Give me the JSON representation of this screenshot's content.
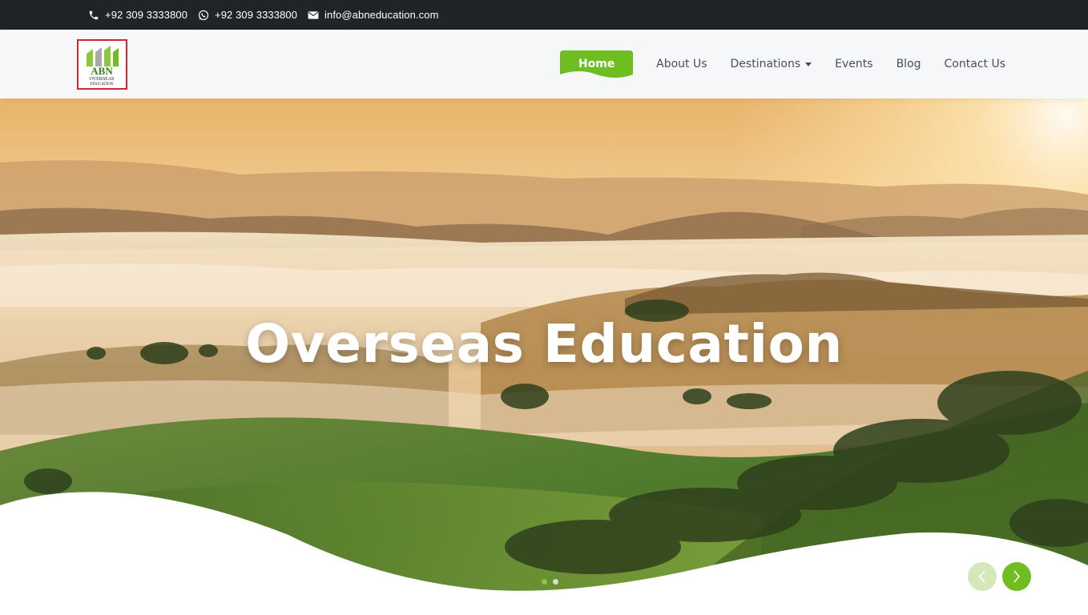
{
  "topbar": {
    "phone": "+92 309 3333800",
    "whatsapp": "+92 309 3333800",
    "email": "info@abneducation.com",
    "icons": [
      "phone-icon",
      "whatsapp-icon",
      "mail-icon"
    ]
  },
  "logo": {
    "letters": "ABN",
    "line1": "OVERSEAS",
    "line2": "EDUCATION"
  },
  "nav": {
    "home": "Home",
    "about": "About Us",
    "destinations": "Destinations",
    "events": "Events",
    "blog": "Blog",
    "contact": "Contact Us"
  },
  "hero": {
    "title": "Overseas Education",
    "slides_total": 2,
    "active_slide": 1
  },
  "colors": {
    "topbar_bg": "#202328",
    "accent_green": "#6fbd20",
    "light_green": "#d4e8b9",
    "nav_text": "#4a4f55"
  }
}
